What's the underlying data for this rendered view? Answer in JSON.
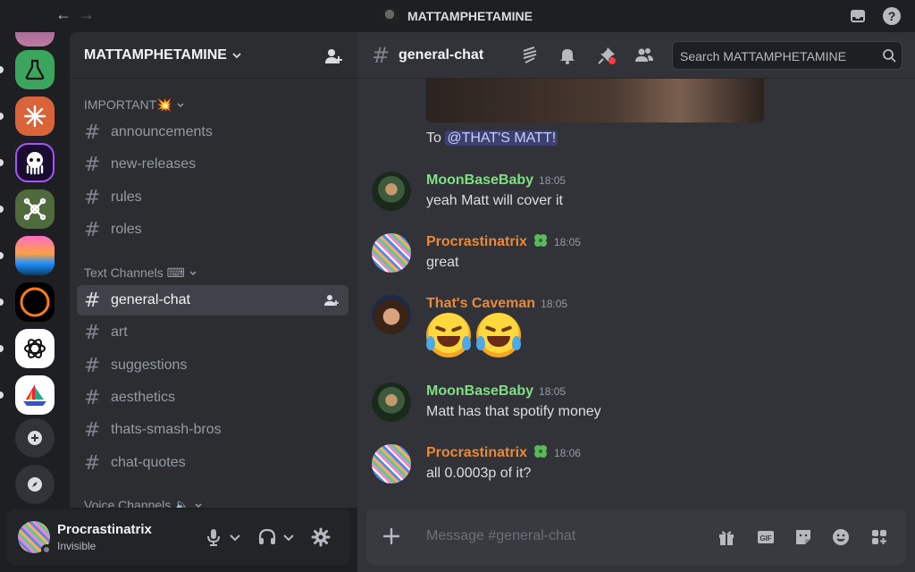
{
  "titlebar": {
    "title": "MATTAMPHETAMINE",
    "back": "←",
    "forward": "→",
    "help": "?"
  },
  "server": {
    "name": "MATTAMPHETAMINE",
    "categories": [
      {
        "label": "IMPORTANT💥"
      },
      {
        "label": "Text Channels ⌨"
      },
      {
        "label": "Voice Channels 🔈"
      }
    ],
    "important_channels": [
      "announcements",
      "new-releases",
      "rules",
      "roles"
    ],
    "text_channels": [
      "general-chat",
      "art",
      "suggestions",
      "aesthetics",
      "thats-smash-bros",
      "chat-quotes"
    ],
    "active_channel": "general-chat",
    "hash": "#"
  },
  "user": {
    "name": "Procrastinatrix",
    "status": "Invisible"
  },
  "chat": {
    "channel": "general-chat",
    "search_placeholder": "Search MATTAMPHETAMINE",
    "mention_prefix": "To ",
    "mention": "@THAT'S MATT!",
    "messages": [
      {
        "author": "MoonBaseBaby",
        "time": "18:05",
        "text": "yeah Matt will cover it",
        "color": "#7ee081"
      },
      {
        "author": "Procrastinatrix",
        "time": "18:05",
        "text": "great",
        "color": "#e8893c"
      },
      {
        "author": "That's Caveman",
        "time": "18:05",
        "text": "🤣🤣",
        "color": "#e8893c"
      },
      {
        "author": "MoonBaseBaby",
        "time": "18:05",
        "text": "Matt has that spotify money",
        "color": "#7ee081"
      },
      {
        "author": "Procrastinatrix",
        "time": "18:06",
        "text": "all 0.0003p of it?",
        "color": "#e8893c"
      }
    ],
    "composer_placeholder": "Message #general-chat",
    "gif_label": "GIF"
  },
  "icons": [
    "back-arrow-icon",
    "forward-arrow-icon",
    "inbox-icon",
    "help-icon",
    "flask-icon",
    "burst-icon",
    "octopus-icon",
    "cross-icon",
    "eclipse-icon",
    "openai-icon",
    "boat-icon",
    "plus-icon",
    "compass-icon",
    "invite-icon",
    "threads-icon",
    "bell-icon",
    "pin-icon",
    "members-icon",
    "search-icon",
    "mic-icon",
    "headphones-icon",
    "gear-icon",
    "gift-icon",
    "gif-icon",
    "sticker-icon",
    "emoji-icon",
    "apps-icon"
  ]
}
